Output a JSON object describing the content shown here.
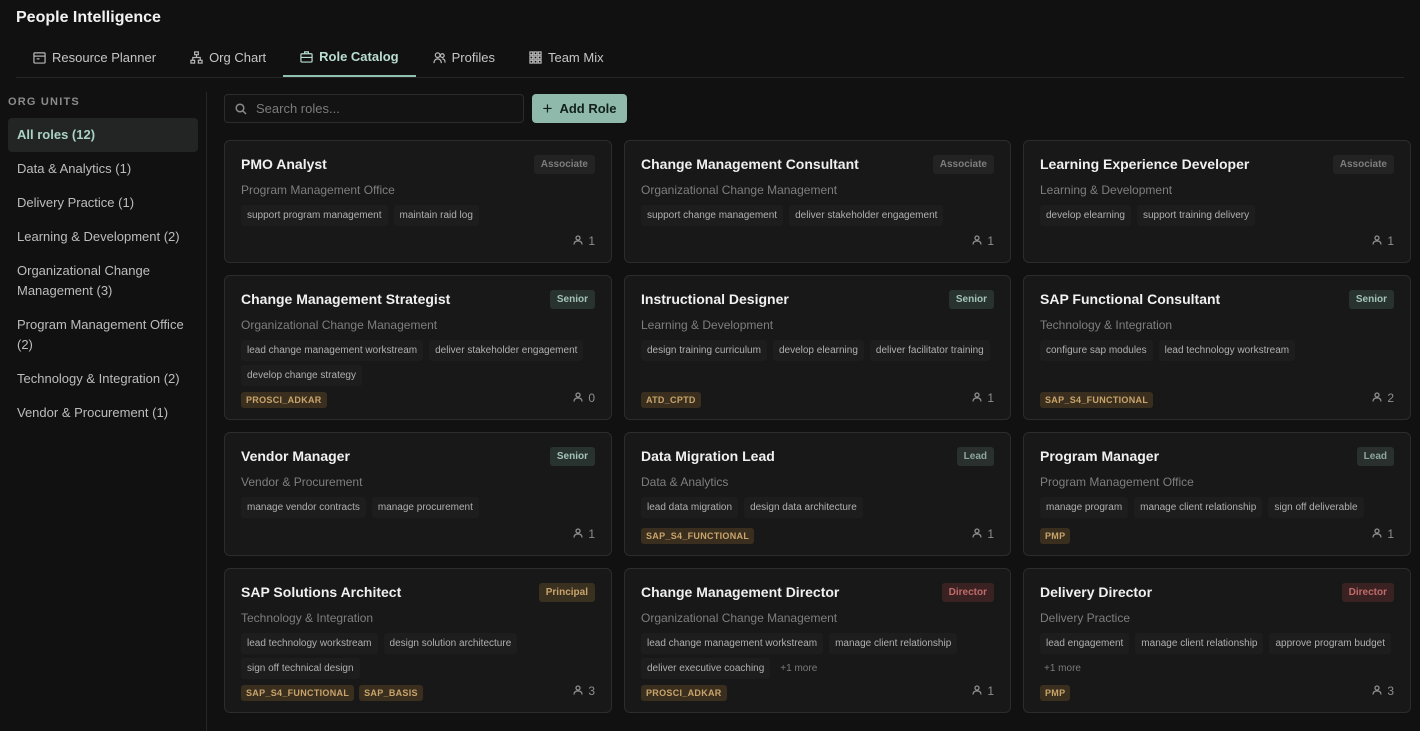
{
  "app": {
    "title": "People Intelligence"
  },
  "tabs": [
    {
      "label": "Resource Planner",
      "icon": "calendar-icon"
    },
    {
      "label": "Org Chart",
      "icon": "org-chart-icon"
    },
    {
      "label": "Role Catalog",
      "icon": "briefcase-icon",
      "active": true
    },
    {
      "label": "Profiles",
      "icon": "users-icon"
    },
    {
      "label": "Team Mix",
      "icon": "grid-icon"
    }
  ],
  "sidebar": {
    "heading": "ORG UNITS",
    "items": [
      {
        "label": "All roles (12)",
        "active": true
      },
      {
        "label": "Data & Analytics (1)"
      },
      {
        "label": "Delivery Practice (1)"
      },
      {
        "label": "Learning & Development (2)"
      },
      {
        "label": "Organizational Change Management (3)"
      },
      {
        "label": "Program Management Office (2)"
      },
      {
        "label": "Technology & Integration (2)"
      },
      {
        "label": "Vendor & Procurement (1)"
      }
    ]
  },
  "toolbar": {
    "search_placeholder": "Search roles...",
    "add_label": "Add Role",
    "add_icon": "plus-icon"
  },
  "roles": [
    {
      "title": "PMO Analyst",
      "level": "Associate",
      "level_kind": "associate",
      "unit": "Program Management Office",
      "skills": [
        "support program management",
        "maintain raid log"
      ],
      "more": "",
      "certs": [],
      "count": "1"
    },
    {
      "title": "Change Management Consultant",
      "level": "Associate",
      "level_kind": "associate",
      "unit": "Organizational Change Management",
      "skills": [
        "support change management",
        "deliver stakeholder engagement"
      ],
      "more": "",
      "certs": [],
      "count": "1"
    },
    {
      "title": "Learning Experience Developer",
      "level": "Associate",
      "level_kind": "associate",
      "unit": "Learning & Development",
      "skills": [
        "develop elearning",
        "support training delivery"
      ],
      "more": "",
      "certs": [],
      "count": "1"
    },
    {
      "title": "Change Management Strategist",
      "level": "Senior",
      "level_kind": "senior",
      "unit": "Organizational Change Management",
      "skills": [
        "lead change management workstream",
        "deliver stakeholder engagement",
        "develop change strategy"
      ],
      "more": "",
      "certs": [
        "PROSCI_ADKAR"
      ],
      "count": "0"
    },
    {
      "title": "Instructional Designer",
      "level": "Senior",
      "level_kind": "senior",
      "unit": "Learning & Development",
      "skills": [
        "design training curriculum",
        "develop elearning",
        "deliver facilitator training"
      ],
      "more": "",
      "certs": [
        "ATD_CPTD"
      ],
      "count": "1"
    },
    {
      "title": "SAP Functional Consultant",
      "level": "Senior",
      "level_kind": "senior",
      "unit": "Technology & Integration",
      "skills": [
        "configure sap modules",
        "lead technology workstream"
      ],
      "more": "",
      "certs": [
        "SAP_S4_FUNCTIONAL"
      ],
      "count": "2"
    },
    {
      "title": "Vendor Manager",
      "level": "Senior",
      "level_kind": "senior",
      "unit": "Vendor & Procurement",
      "skills": [
        "manage vendor contracts",
        "manage procurement"
      ],
      "more": "",
      "certs": [],
      "count": "1"
    },
    {
      "title": "Data Migration Lead",
      "level": "Lead",
      "level_kind": "lead",
      "unit": "Data & Analytics",
      "skills": [
        "lead data migration",
        "design data architecture"
      ],
      "more": "",
      "certs": [
        "SAP_S4_FUNCTIONAL"
      ],
      "count": "1"
    },
    {
      "title": "Program Manager",
      "level": "Lead",
      "level_kind": "lead",
      "unit": "Program Management Office",
      "skills": [
        "manage program",
        "manage client relationship",
        "sign off deliverable"
      ],
      "more": "",
      "certs": [
        "PMP"
      ],
      "count": "1"
    },
    {
      "title": "SAP Solutions Architect",
      "level": "Principal",
      "level_kind": "principal",
      "unit": "Technology & Integration",
      "skills": [
        "lead technology workstream",
        "design solution architecture",
        "sign off technical design"
      ],
      "more": "",
      "certs": [
        "SAP_S4_FUNCTIONAL",
        "SAP_BASIS"
      ],
      "count": "3"
    },
    {
      "title": "Change Management Director",
      "level": "Director",
      "level_kind": "director",
      "unit": "Organizational Change Management",
      "skills": [
        "lead change management workstream",
        "manage client relationship",
        "deliver executive coaching"
      ],
      "more": "+1 more",
      "certs": [
        "PROSCI_ADKAR"
      ],
      "count": "1"
    },
    {
      "title": "Delivery Director",
      "level": "Director",
      "level_kind": "director",
      "unit": "Delivery Practice",
      "skills": [
        "lead engagement",
        "manage client relationship",
        "approve program budget"
      ],
      "more": "+1 more",
      "certs": [
        "PMP"
      ],
      "count": "3"
    }
  ],
  "colors": {
    "accent": "#8fb9ab",
    "background": "#111111",
    "card": "#181818"
  }
}
